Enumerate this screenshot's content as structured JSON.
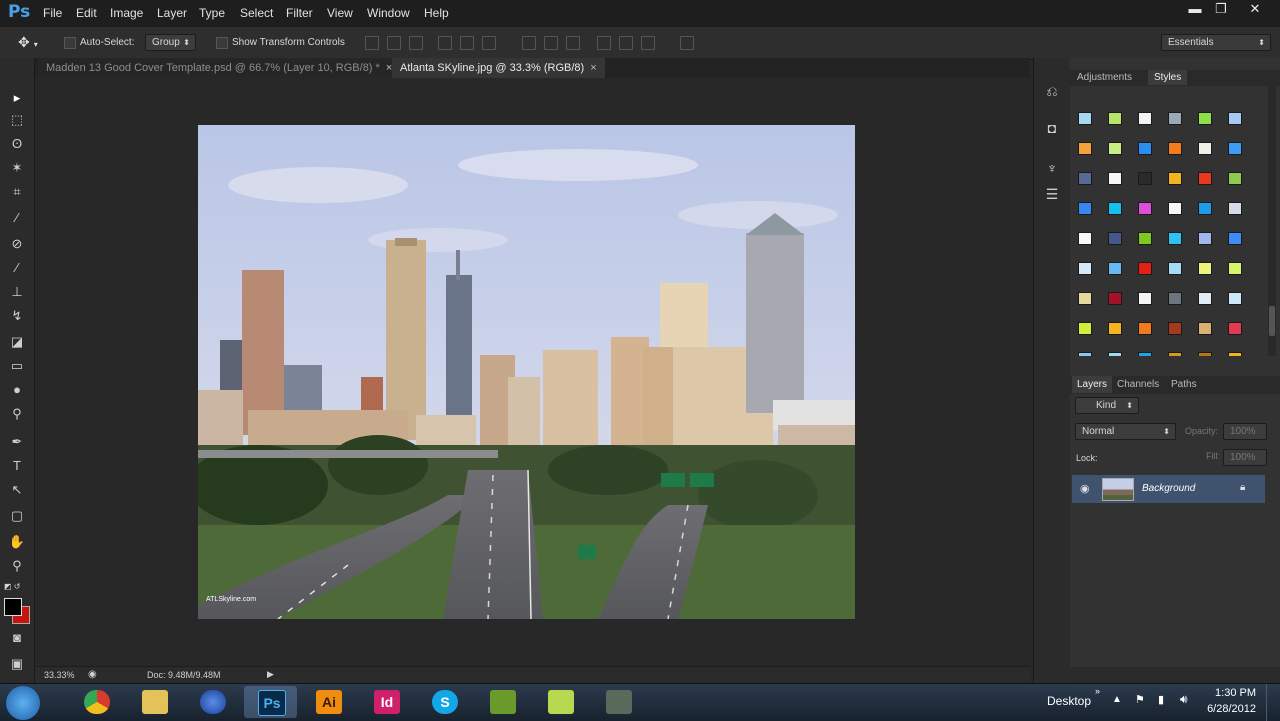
{
  "app": {
    "logo": "Ps"
  },
  "menu": [
    "File",
    "Edit",
    "Image",
    "Layer",
    "Type",
    "Select",
    "Filter",
    "View",
    "Window",
    "Help"
  ],
  "window_controls": {
    "minimize": "▬",
    "restore": "❐",
    "close": "✕"
  },
  "options_bar": {
    "auto_select_label": "Auto-Select:",
    "auto_select_value": "Group",
    "show_transform_label": "Show Transform Controls",
    "workspace": "Essentials"
  },
  "tabs": [
    {
      "title": "Madden 13 Good Cover Template.psd @ 66.7% (Layer 10, RGB/8) *",
      "close": "×",
      "active": false
    },
    {
      "title": "Atlanta SKyline.jpg @ 33.3% (RGB/8)",
      "close": "×",
      "active": true
    }
  ],
  "status": {
    "zoom": "33.33%",
    "doc": "Doc: 9.48M/9.48M"
  },
  "image": {
    "watermark": "ATLSkyline.com"
  },
  "panels": {
    "top_tabs": [
      "Adjustments",
      "Styles"
    ],
    "layers_tabs": [
      "Layers",
      "Channels",
      "Paths"
    ],
    "kind_label": "Kind",
    "blend_mode": "Normal",
    "opacity_label": "Opacity:",
    "opacity_value": "100%",
    "lock_label": "Lock:",
    "fill_label": "Fill:",
    "fill_value": "100%",
    "layers": [
      {
        "name": "Background",
        "visible": true,
        "locked": true
      }
    ]
  },
  "swatch_colors": [
    [
      "#a8d8f0",
      "#b7e36a",
      "#f3f3f3",
      "#9aa9b8",
      "#8ee04a",
      "#a7c8f3"
    ],
    [
      "#f3a33a",
      "#c9ee84",
      "#2a8df0",
      "#f57b1c",
      "#f0f0e6",
      "#3f9cf6"
    ],
    [
      "#566a93",
      "#f6f6f6",
      "#2a2a2a",
      "#f2b521",
      "#e8391f",
      "#8ccb4d"
    ],
    [
      "#3a86f0",
      "#16c0ee",
      "#dd4fd8",
      "#f7f7f7",
      "#1f9ae8",
      "#d5dbe8"
    ],
    [
      "#f9f9f9",
      "#46578c",
      "#7ec820",
      "#2fc1f4",
      "#9fb7ea",
      "#3f8df4"
    ],
    [
      "#d6e8f7",
      "#68b8f3",
      "#e32011",
      "#a6daf6",
      "#ecf47c",
      "#d7f56a"
    ],
    [
      "#e4d8a0",
      "#a31226",
      "#f5f5f5",
      "#6c7580",
      "#e0ecf6",
      "#cfe8f7"
    ],
    [
      "#d3ee3a",
      "#f4b420",
      "#f37a1c",
      "#a43a1c",
      "#dab070",
      "#e33a52"
    ],
    [
      "#8cc8f0",
      "#9fd9f4",
      "#18a8e4",
      "#d39c16",
      "#b4761a",
      "#f2b31e"
    ]
  ],
  "taskbar": {
    "apps": [
      {
        "name": "chrome",
        "label": ""
      },
      {
        "name": "explorer",
        "label": ""
      },
      {
        "name": "firefox",
        "label": ""
      },
      {
        "name": "photoshop",
        "label": "Ps"
      },
      {
        "name": "illustrator",
        "label": "Ai"
      },
      {
        "name": "indesign",
        "label": "Id"
      },
      {
        "name": "skype",
        "label": "S"
      },
      {
        "name": "app7",
        "label": ""
      },
      {
        "name": "app8",
        "label": ""
      },
      {
        "name": "app9",
        "label": ""
      }
    ],
    "desktop_label": "Desktop",
    "time": "1:30 PM",
    "date": "6/28/2012"
  }
}
